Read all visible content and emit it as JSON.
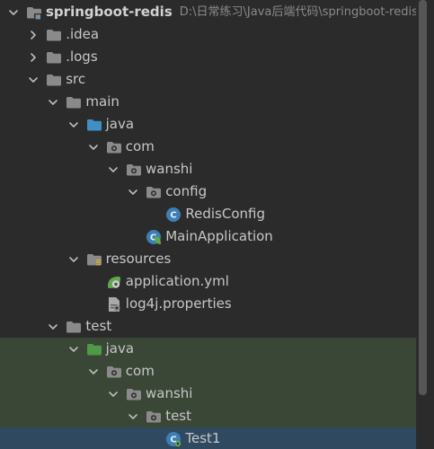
{
  "tree": [
    {
      "id": "springboot-redis",
      "label": "springboot-redis",
      "path": "D:\\日常练习\\Java后端代码\\springboot-redis",
      "icon": "module-folder-icon",
      "expanded": true,
      "depth": 0
    },
    {
      "id": "idea",
      "label": ".idea",
      "icon": "folder-icon",
      "expanded": false,
      "depth": 1
    },
    {
      "id": "logs",
      "label": ".logs",
      "icon": "folder-icon",
      "expanded": false,
      "depth": 1
    },
    {
      "id": "src",
      "label": "src",
      "icon": "folder-icon",
      "expanded": true,
      "depth": 1
    },
    {
      "id": "main",
      "label": "main",
      "icon": "folder-icon",
      "expanded": true,
      "depth": 2
    },
    {
      "id": "main-java",
      "label": "java",
      "icon": "source-root-icon",
      "expanded": true,
      "depth": 3
    },
    {
      "id": "main-com",
      "label": "com",
      "icon": "package-icon",
      "expanded": true,
      "depth": 4
    },
    {
      "id": "main-wanshi",
      "label": "wanshi",
      "icon": "package-icon",
      "expanded": true,
      "depth": 5
    },
    {
      "id": "config",
      "label": "config",
      "icon": "package-icon",
      "expanded": true,
      "depth": 6
    },
    {
      "id": "redisconfig",
      "label": "RedisConfig",
      "icon": "class-icon",
      "depth": 7
    },
    {
      "id": "mainapplication",
      "label": "MainApplication",
      "icon": "spring-class-icon",
      "depth": 6
    },
    {
      "id": "resources",
      "label": "resources",
      "icon": "resources-icon",
      "expanded": true,
      "depth": 3
    },
    {
      "id": "application-yml",
      "label": "application.yml",
      "icon": "spring-config-icon",
      "depth": 4
    },
    {
      "id": "log4j",
      "label": "log4j.properties",
      "icon": "properties-icon",
      "depth": 4
    },
    {
      "id": "test",
      "label": "test",
      "icon": "folder-icon",
      "expanded": true,
      "depth": 2
    },
    {
      "id": "test-java",
      "label": "java",
      "icon": "test-root-icon",
      "expanded": true,
      "depth": 3
    },
    {
      "id": "test-com",
      "label": "com",
      "icon": "package-icon",
      "expanded": true,
      "depth": 4
    },
    {
      "id": "test-wanshi",
      "label": "wanshi",
      "icon": "package-icon",
      "expanded": true,
      "depth": 5
    },
    {
      "id": "test-pkg",
      "label": "test",
      "icon": "package-icon",
      "expanded": true,
      "depth": 6
    },
    {
      "id": "test1",
      "label": "Test1",
      "icon": "test-class-icon",
      "depth": 7
    }
  ],
  "colors": {
    "background": "#2b2b2b",
    "folder": "#8a8a8a",
    "source_root": "#3f8fc4",
    "test_root": "#4f9a46",
    "class_blue": "#3d7fb5",
    "spring_green": "#62a84b"
  }
}
